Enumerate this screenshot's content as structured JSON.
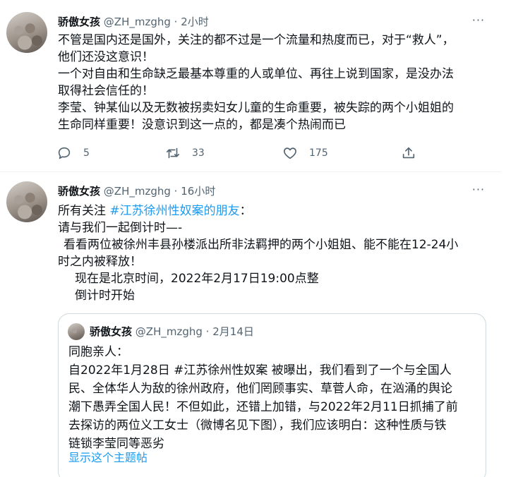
{
  "tweets": [
    {
      "name": "骄傲女孩",
      "handle": "@ZH_mzghg",
      "dot": "·",
      "time": "2小时",
      "lines": [
        "不管是国内还是国外，关注的都不过是一个流量和热度而已，对于“救人”，",
        "他们还没这意识！",
        "一个对自由和生命缺乏最基本尊重的人或单位、再往上说到国家，是没办法",
        "取得社会信任的！",
        "李莹、钟某仙以及无数被拐卖妇女儿童的生命重要，被失踪的两个小姐姐的",
        "生命同样重要！没意识到这一点的，都是凑个热闹而已"
      ],
      "actions": {
        "reply_count": "5",
        "retweet_count": "33",
        "like_count": "175"
      }
    },
    {
      "name": "骄傲女孩",
      "handle": "@ZH_mzghg",
      "dot": "·",
      "time": "16小时",
      "line1_prefix": "所有关注 ",
      "line1_hashtag": "#江苏徐州性奴案的朋友",
      "line1_suffix": "：",
      "lines": [
        "请与我们一起倒计时—-",
        "看看两位被徐州丰县孙楼派出所非法羁押的两个小姐姐、能不能在12-24小",
        "时之内被释放！",
        "现在是北京时间，2022年2月17日19:00点整",
        "倒计时开始"
      ],
      "quote": {
        "name": "骄傲女孩",
        "handle": "@ZH_mzghg",
        "dot": "·",
        "time": "2月14日",
        "lines": [
          "同胞亲人：",
          "自2022年1月28日 #江苏徐州性奴案 被曝出，我们看到了一个与全国人",
          "民、全体华人为敌的徐州政府，他们罔顾事实、草菅人命，在汹涌的舆论",
          "潮下愚弄全国人民！不但如此，还错上加错，与2022年2月11日抓捕了前",
          "去探访的两位义工女士（微博名见下图），我们应该明白：这种性质与铁",
          "链锁李莹同等恶劣"
        ],
        "show_thread": "显示这个主题帖"
      }
    }
  ],
  "more_label": "···",
  "colors": {
    "link": "#1d9bf0",
    "secondary": "#536471",
    "border": "#cfd9de"
  }
}
